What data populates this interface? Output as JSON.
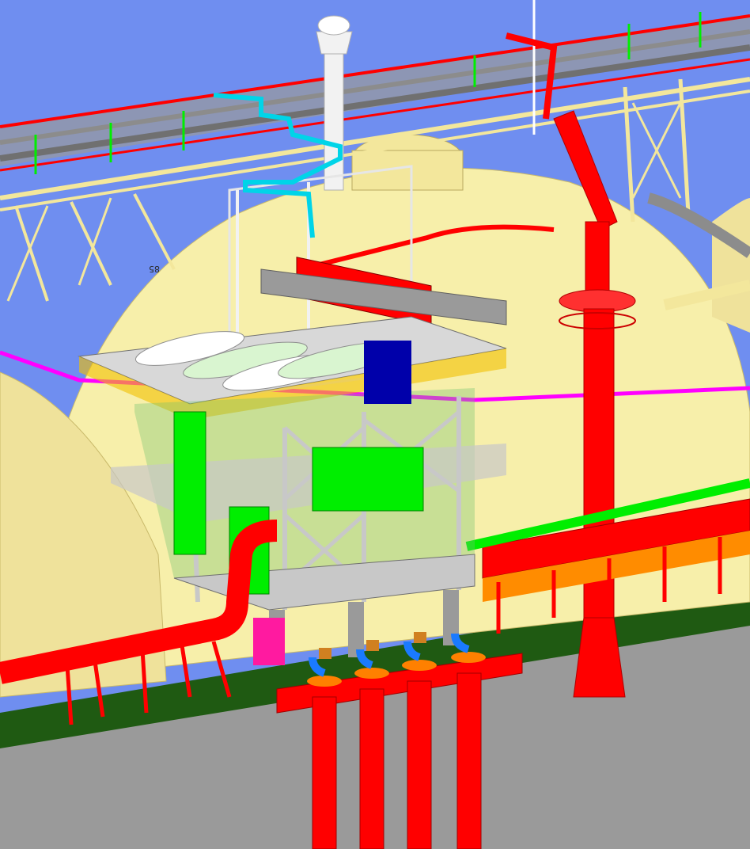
{
  "scene": {
    "sky_color": "#6f8ef0",
    "ground_color": "#9a9a9a",
    "grass_color": "#1f5a12",
    "tank_color": "#f7efaa",
    "tank_shade": "#e6d88e",
    "rack_color": "#f3e79c",
    "pipe_red": "#ff0000",
    "pipe_gray": "#8c8c8c",
    "pipe_green": "#00ee00",
    "pipe_cyan": "#00d4e8",
    "pipe_magenta": "#ff00ff",
    "steel_white": "#f2f2f2",
    "orange_platform": "#ff8c00"
  },
  "annotations": {
    "elevation_label": "85"
  }
}
